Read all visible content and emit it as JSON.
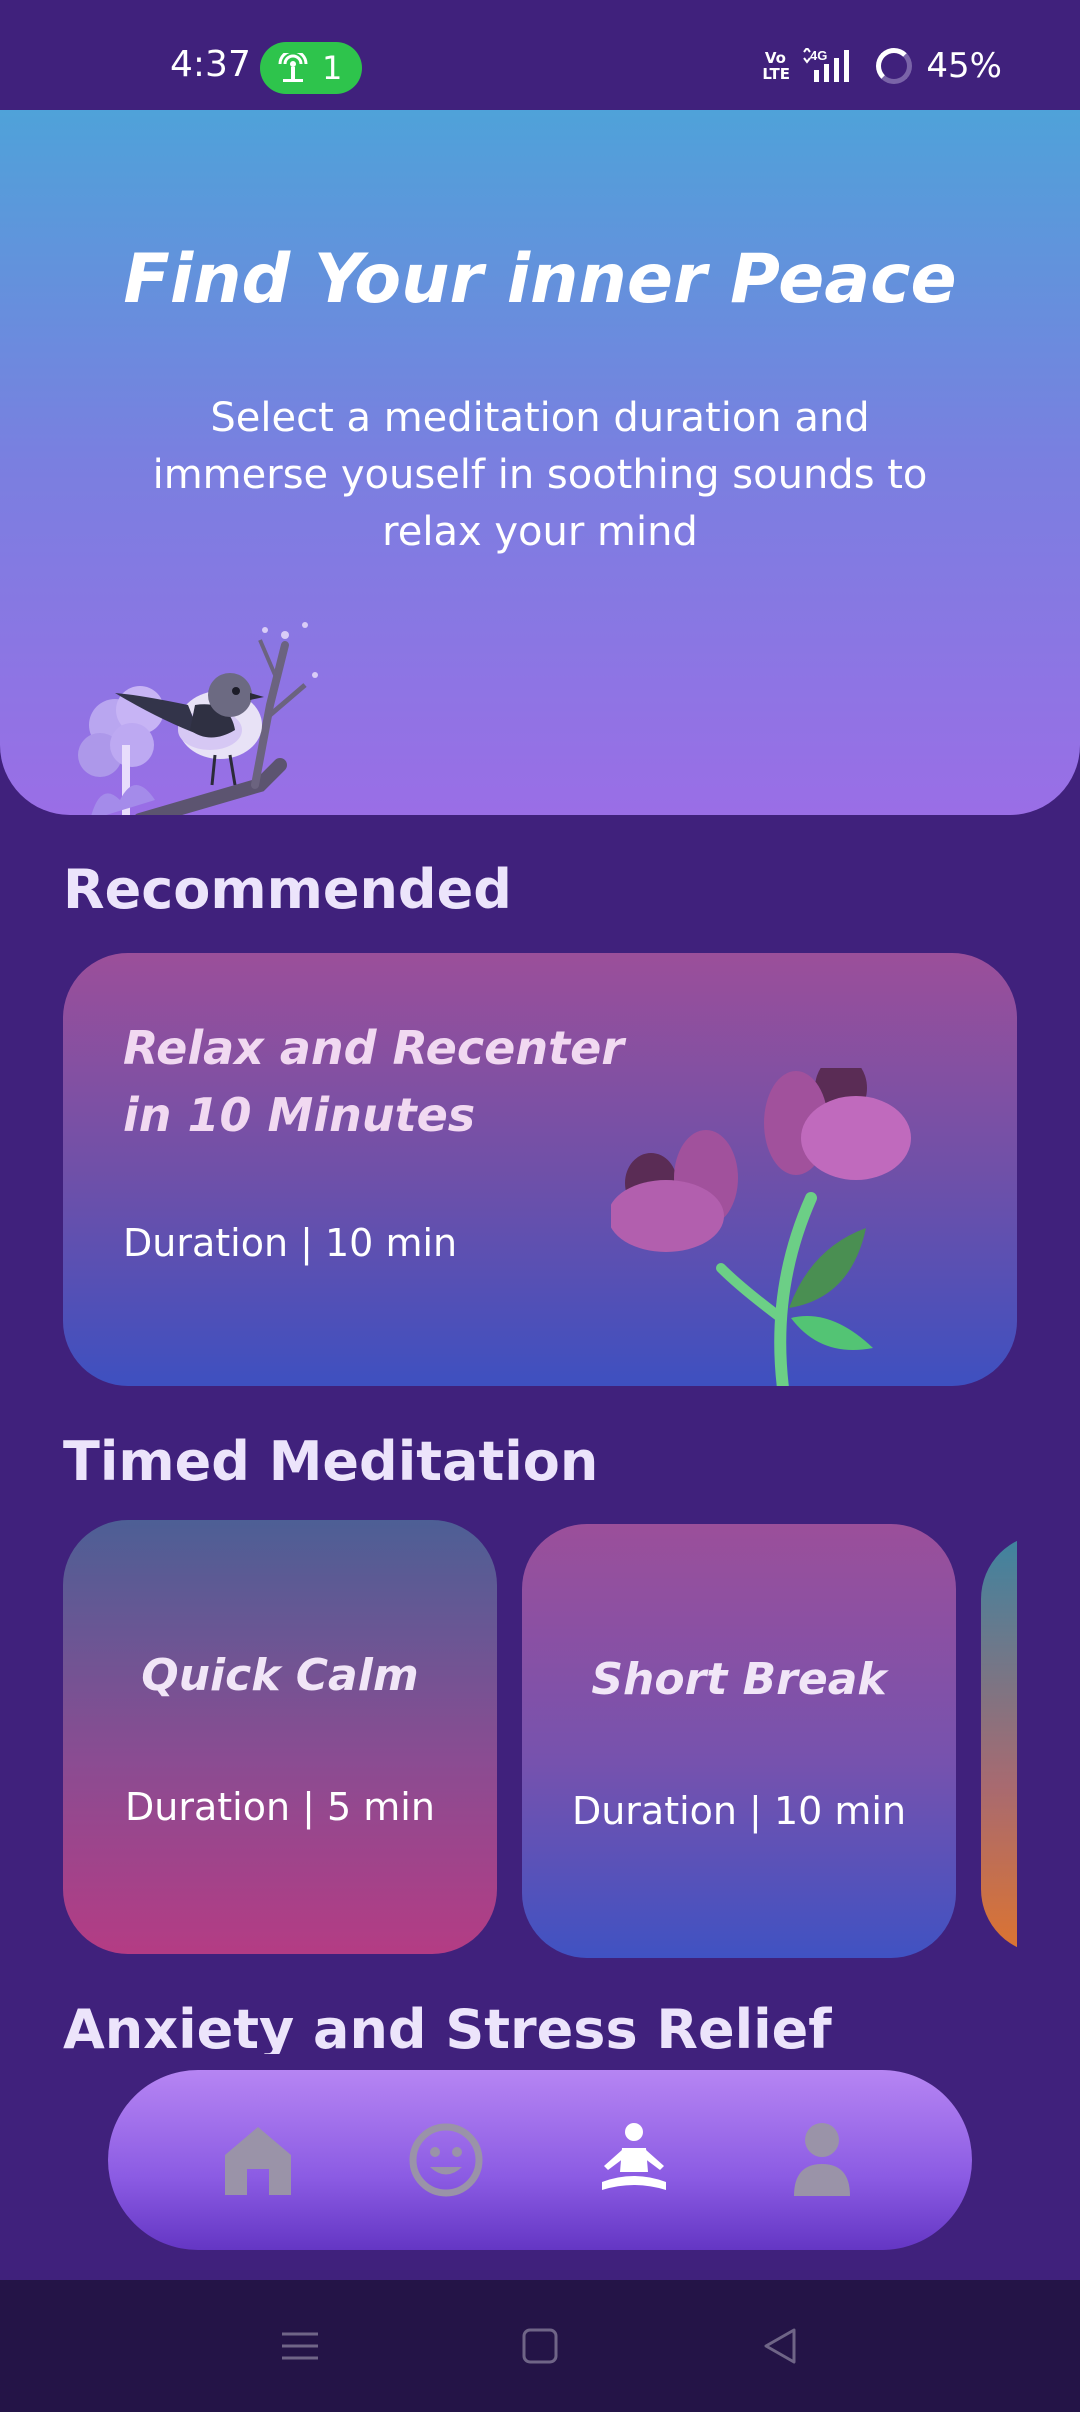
{
  "status": {
    "time": "4:37",
    "hotspot_count": "1",
    "volte_label": "Vo\nLTE",
    "network_label": "4G",
    "battery": "45%"
  },
  "hero": {
    "title": "Find Your inner Peace",
    "subtitle": "Select a meditation duration and immerse youself in soothing sounds to relax your mind"
  },
  "recommended": {
    "section_title": "Recommended",
    "card": {
      "title": "Relax and Recenter in 10 Minutes",
      "duration": "Duration | 10 min"
    }
  },
  "timed": {
    "section_title": "Timed Meditation",
    "cards": [
      {
        "title": "Quick Calm",
        "duration": "Duration | 5 min"
      },
      {
        "title": "Short Break",
        "duration": "Duration | 10 min"
      },
      {
        "title": "",
        "duration": ""
      }
    ]
  },
  "anxiety": {
    "section_title": "Anxiety and Stress Relief"
  },
  "bottom_nav": {
    "items": [
      {
        "icon": "home-icon"
      },
      {
        "icon": "smile-icon"
      },
      {
        "icon": "meditation-icon"
      },
      {
        "icon": "profile-icon"
      }
    ]
  },
  "system_nav": {
    "items": [
      "menu-icon",
      "home-square-icon",
      "back-icon"
    ]
  },
  "colors": {
    "background": "#40217c",
    "hero_top": "#4fa2d9",
    "hero_bottom": "#9a6ee6",
    "nav_gradient_top": "#b685f3",
    "nav_gradient_bottom": "#6436c4",
    "hotspot_green": "#2ec44c",
    "system_nav_bg": "#241447"
  }
}
